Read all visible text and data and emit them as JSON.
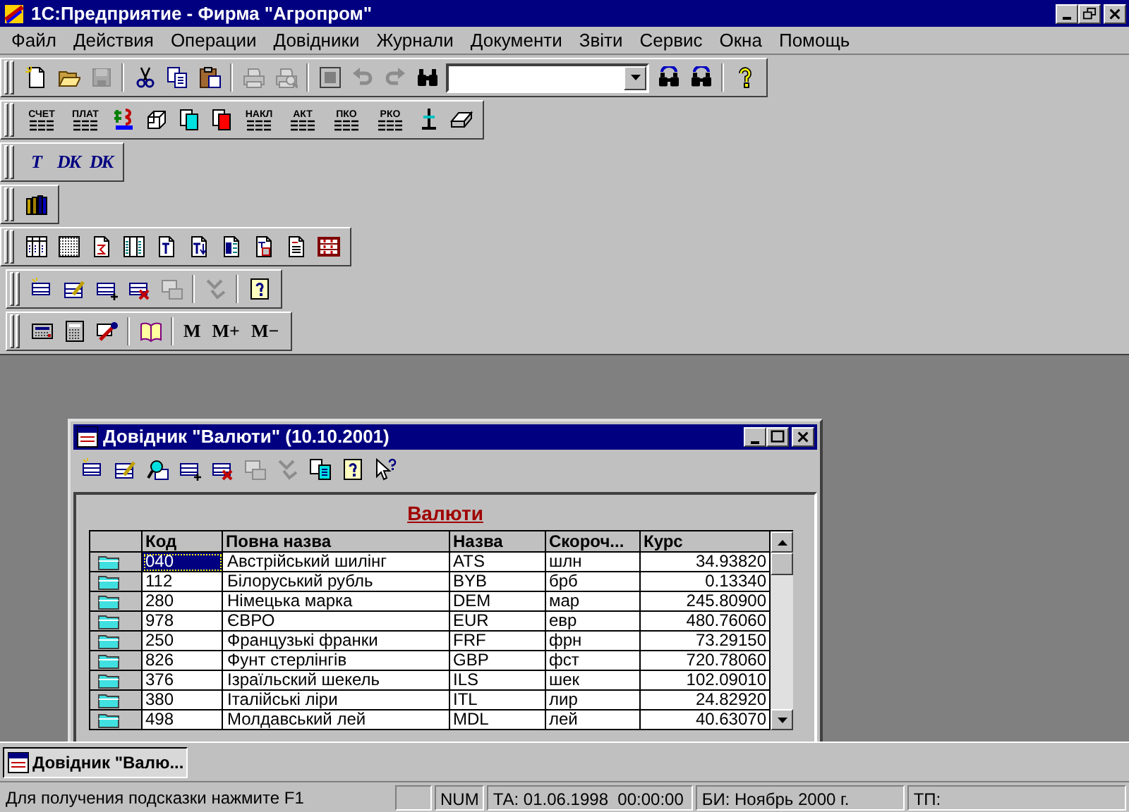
{
  "app": {
    "title": "1С:Предприятие - Фирма \"Агропром\""
  },
  "menu": [
    "Файл",
    "Действия",
    "Операции",
    "Довідники",
    "Журнали",
    "Документи",
    "Звіти",
    "Сервис",
    "Окна",
    "Помощь"
  ],
  "toolbars": [
    {
      "items": [
        {
          "kind": "icon",
          "disabled": false
        },
        {
          "kind": "icon",
          "disabled": false
        },
        {
          "kind": "icon",
          "disabled": true
        },
        {
          "kind": "separator"
        },
        {
          "kind": "icon",
          "disabled": false
        },
        {
          "kind": "icon",
          "disabled": false
        },
        {
          "kind": "icon",
          "disabled": false
        },
        {
          "kind": "separator"
        },
        {
          "kind": "icon",
          "disabled": true
        },
        {
          "kind": "icon",
          "disabled": true
        },
        {
          "kind": "separator"
        },
        {
          "kind": "icon",
          "disabled": false
        },
        {
          "kind": "icon",
          "disabled": true
        },
        {
          "kind": "icon",
          "disabled": true
        },
        {
          "kind": "icon",
          "disabled": false
        },
        {
          "kind": "combo"
        },
        {
          "kind": "icon",
          "disabled": false
        },
        {
          "kind": "icon",
          "disabled": false
        },
        {
          "kind": "separator"
        },
        {
          "kind": "icon",
          "disabled": false
        }
      ]
    },
    {
      "items": [
        {
          "kind": "text",
          "label": "СЧЕТ"
        },
        {
          "kind": "text",
          "label": "ПЛАТ"
        },
        {
          "kind": "icon",
          "disabled": false
        },
        {
          "kind": "icon",
          "disabled": false
        },
        {
          "kind": "icon",
          "disabled": false
        },
        {
          "kind": "icon",
          "disabled": false
        },
        {
          "kind": "text",
          "label": "НАКЛ"
        },
        {
          "kind": "text",
          "label": "АКТ"
        },
        {
          "kind": "text",
          "label": "ПКО"
        },
        {
          "kind": "text",
          "label": "РКО"
        },
        {
          "kind": "icon",
          "disabled": false
        },
        {
          "kind": "icon",
          "disabled": false
        }
      ]
    },
    {
      "items": [
        {
          "kind": "glyph",
          "label": "Т"
        },
        {
          "kind": "glyph",
          "label": "DK"
        },
        {
          "kind": "glyph",
          "label": "DK"
        }
      ]
    },
    {
      "items": [
        {
          "kind": "icon",
          "disabled": false
        }
      ]
    },
    {
      "items": [
        {
          "kind": "icon",
          "disabled": false
        },
        {
          "kind": "icon",
          "disabled": false
        },
        {
          "kind": "icon",
          "disabled": false
        },
        {
          "kind": "icon",
          "disabled": false
        },
        {
          "kind": "icon",
          "disabled": false
        },
        {
          "kind": "icon",
          "disabled": false
        },
        {
          "kind": "icon",
          "disabled": false
        },
        {
          "kind": "icon",
          "disabled": false
        },
        {
          "kind": "icon",
          "disabled": false
        },
        {
          "kind": "icon",
          "disabled": false
        }
      ]
    },
    {
      "items": [
        {
          "kind": "icon",
          "disabled": false
        },
        {
          "kind": "icon",
          "disabled": false
        },
        {
          "kind": "icon",
          "disabled": false
        },
        {
          "kind": "icon",
          "disabled": false
        },
        {
          "kind": "icon",
          "disabled": true
        },
        {
          "kind": "separator"
        },
        {
          "kind": "icon",
          "disabled": true
        },
        {
          "kind": "separator"
        },
        {
          "kind": "icon",
          "disabled": false
        }
      ]
    },
    {
      "items": [
        {
          "kind": "icon",
          "disabled": false
        },
        {
          "kind": "icon",
          "disabled": false
        },
        {
          "kind": "icon",
          "disabled": false
        },
        {
          "kind": "separator"
        },
        {
          "kind": "icon",
          "disabled": false
        },
        {
          "kind": "separator"
        },
        {
          "kind": "memory",
          "label": "M"
        },
        {
          "kind": "memory",
          "label": "M+"
        },
        {
          "kind": "memory",
          "label": "M−"
        }
      ]
    }
  ],
  "child_window": {
    "title": "Довідник \"Валюти\" (10.10.2001)",
    "toolbar": [
      {
        "disabled": false
      },
      {
        "disabled": false
      },
      {
        "disabled": false
      },
      {
        "disabled": false
      },
      {
        "disabled": false
      },
      {
        "disabled": true
      },
      {
        "disabled": true
      },
      {
        "disabled": false
      },
      {
        "disabled": false
      },
      {
        "disabled": false
      }
    ],
    "heading": "Валюти",
    "table": {
      "columns": [
        "Код",
        "Повна назва",
        "Назва",
        "Скороч...",
        "Курс"
      ],
      "rows": [
        {
          "code": "040",
          "full_name": "Австрійський шилінг",
          "name": "ATS",
          "short": "шлн",
          "rate": "34.93820",
          "selected": true
        },
        {
          "code": "112",
          "full_name": "Білоруський рубль",
          "name": "BYB",
          "short": "брб",
          "rate": "0.13340",
          "selected": false
        },
        {
          "code": "280",
          "full_name": "Німецька марка",
          "name": "DEM",
          "short": "мар",
          "rate": "245.80900",
          "selected": false
        },
        {
          "code": "978",
          "full_name": "ЄВРО",
          "name": "EUR",
          "short": "евр",
          "rate": "480.76060",
          "selected": false
        },
        {
          "code": "250",
          "full_name": "Французькі франки",
          "name": "FRF",
          "short": "фрн",
          "rate": "73.29150",
          "selected": false
        },
        {
          "code": "826",
          "full_name": "Фунт стерлінгів",
          "name": "GBP",
          "short": "фст",
          "rate": "720.78060",
          "selected": false
        },
        {
          "code": "376",
          "full_name": "Ізраїльский шекель",
          "name": "ILS",
          "short": "шек",
          "rate": "102.09010",
          "selected": false
        },
        {
          "code": "380",
          "full_name": "Італійські ліри",
          "name": "ITL",
          "short": "лир",
          "rate": "24.82920",
          "selected": false
        },
        {
          "code": "498",
          "full_name": "Молдавський лей",
          "name": "MDL",
          "short": "лей",
          "rate": "40.63070",
          "selected": false
        }
      ]
    }
  },
  "taskbar": [
    {
      "label": "Довідник \"Валю...",
      "selected": true
    }
  ],
  "status_bar": {
    "hint": "Для получения подсказки нажмите F1",
    "indicators": [
      "NUM"
    ],
    "fields": [
      "ТА: 01.06.1998  00:00:00",
      "БИ: Ноябрь 2000 г.",
      "ТП:"
    ]
  }
}
